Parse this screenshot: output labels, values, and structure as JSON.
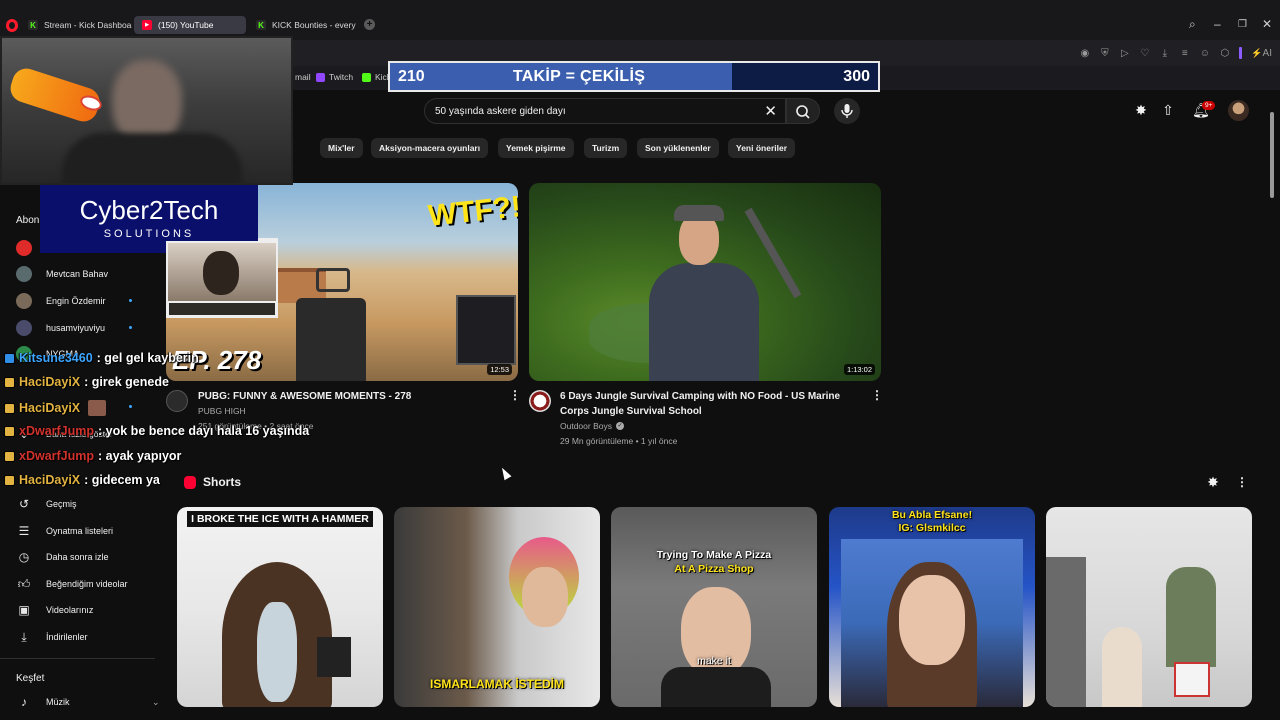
{
  "browser": {
    "tabs": [
      {
        "label": "Stream - Kick Dashboard",
        "icon": "kick-icon"
      },
      {
        "label": "(150) YouTube",
        "icon": "youtube-icon"
      },
      {
        "label": "KICK Bounties - every pla",
        "icon": "kick-icon"
      }
    ],
    "bookmarks": [
      {
        "label": "mail"
      },
      {
        "label": "Twitch"
      },
      {
        "label": "Kick"
      }
    ],
    "ai_label": "AI"
  },
  "follow_goal": {
    "current": "210",
    "label": "TAKİP = ÇEKİLİŞ",
    "target": "300",
    "progress": 0.7
  },
  "youtube": {
    "search_query": "50 yaşında askere giden dayı",
    "notifications": "9+",
    "chips": [
      "Mix'ler",
      "Aksiyon-macera oyunları",
      "Yemek pişirme",
      "Turizm",
      "Son yüklenenler",
      "Yeni öneriler"
    ],
    "sidebar": {
      "subs_heading": "Abon",
      "subscriptions": [
        {
          "label": ""
        },
        {
          "label": "Mevtcan Bahav"
        },
        {
          "label": "Engin Özdemir"
        },
        {
          "label": "husamviyuviyu"
        },
        {
          "label": "NYGMA"
        }
      ],
      "more_label": "Daha fazla göster",
      "you_items": [
        {
          "label": "Geçmiş",
          "icon": "history-icon"
        },
        {
          "label": "Oynatma listeleri",
          "icon": "playlist-icon"
        },
        {
          "label": "Daha sonra izle",
          "icon": "watch-later-icon"
        },
        {
          "label": "Beğendiğim videolar",
          "icon": "thumbs-up-icon"
        },
        {
          "label": "Videolarınız",
          "icon": "your-videos-icon"
        },
        {
          "label": "İndirilenler",
          "icon": "download-icon"
        }
      ],
      "explore_heading": "Keşfet",
      "explore_items": [
        {
          "label": "Müzik",
          "icon": "music-icon"
        }
      ]
    },
    "videos": [
      {
        "title": "PUBG: FUNNY & AWESOME MOMENTS - 278",
        "channel": "PUBG HIGH",
        "meta": "251 görüntüleme • 2 saat önce",
        "duration": "12:53",
        "thumb_text": "EP. 278",
        "thumb_badge": "WTF?!"
      },
      {
        "title_line1": "6 Days Jungle Survival Camping with NO Food - US Marine",
        "title_line2": "Corps Jungle Survival School",
        "channel": "Outdoor Boys",
        "meta": "29 Mn görüntüleme • 1 yıl önce",
        "duration": "1:13:02"
      }
    ],
    "shorts_label": "Shorts",
    "shorts": [
      {
        "caption": "I BROKE THE ICE WITH A HAMMER"
      },
      {
        "caption": "ISMARLAMAK İSTEDİM"
      },
      {
        "caption_top": "Trying To Make A Pizza",
        "caption_top2": "At A Pizza Shop",
        "caption_mid": "make it"
      },
      {
        "caption_top": "Bu Abla Efsane!",
        "caption_top2": "IG: Glsmkilcc"
      },
      {
        "caption": ""
      }
    ]
  },
  "stream_overlay": {
    "brand_title": "Cyber2Tech",
    "brand_sub": "SOLUTIONS",
    "chat": [
      {
        "user": "Kitsune3460",
        "message": ": gel gel kayberin",
        "color": "#3ea6ff",
        "badge": "blue"
      },
      {
        "user": "HaciDayiX",
        "message": ": girek genede",
        "color": "#e3b341",
        "badge": "gold"
      },
      {
        "user": "HaciDayiX",
        "message": "",
        "color": "#e3b341",
        "badge": "gold"
      },
      {
        "user": "xDwarfJump",
        "message": ": yok be bence dayı hala 16 yaşında",
        "color": "#d1322d",
        "badge": "gold"
      },
      {
        "user": "xDwarfJump",
        "message": ": ayak yapıyor",
        "color": "#d1322d",
        "badge": "gold"
      },
      {
        "user": "HaciDayiX",
        "message": ": gidecem ya",
        "color": "#e3b341",
        "badge": "gold"
      }
    ]
  }
}
